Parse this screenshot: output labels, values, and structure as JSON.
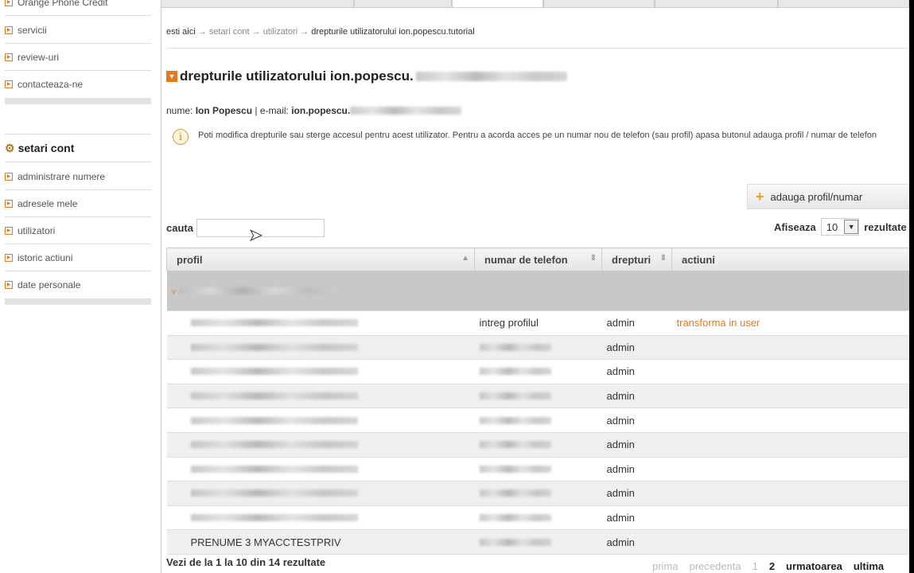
{
  "sidebar": {
    "top_items": [
      "Orange Phone Credit",
      "servicii",
      "review-uri",
      "contacteaza-ne"
    ],
    "section_title": "setari cont",
    "section_items": [
      "administrare numere",
      "adresele mele",
      "utilizatori",
      "istoric actiuni",
      "date personale"
    ]
  },
  "breadcrumb": {
    "prefix": "esti aici",
    "items": [
      "setari cont",
      "utilizatori"
    ],
    "current": "drepturile utilizatorului ion.popescu.tutorial",
    "arrow": "→"
  },
  "page": {
    "title": "drepturile utilizatorului ion.popescu.",
    "name_label": "nume:",
    "name": "Ion Popescu",
    "sep": "|",
    "email_label": "e-mail:",
    "email": "ion.popescu.",
    "info": "Poti modifica drepturile sau sterge accesul pentru acest utilizator. Pentru a acorda acces pe un numar nou de telefon (sau profil) apasa butonul adauga profil / numar de telefon",
    "add_button": "adauga profil/numar",
    "search_label": "cauta",
    "search_value": "",
    "show_label": "Afiseaza",
    "show_value": "10",
    "show_suffix": "rezultate"
  },
  "table": {
    "headers": [
      "profil",
      "numar de telefon",
      "drepturi",
      "actiuni"
    ],
    "rows": [
      {
        "profil": "",
        "phone": "intreg profilul",
        "rights": "admin",
        "action": "transforma in user"
      },
      {
        "profil": "",
        "phone": "",
        "rights": "admin",
        "action": ""
      },
      {
        "profil": "",
        "phone": "",
        "rights": "admin",
        "action": ""
      },
      {
        "profil": "",
        "phone": "",
        "rights": "admin",
        "action": ""
      },
      {
        "profil": "",
        "phone": "",
        "rights": "admin",
        "action": ""
      },
      {
        "profil": "",
        "phone": "",
        "rights": "admin",
        "action": ""
      },
      {
        "profil": "",
        "phone": "",
        "rights": "admin",
        "action": ""
      },
      {
        "profil": "",
        "phone": "",
        "rights": "admin",
        "action": ""
      },
      {
        "profil": "",
        "phone": "",
        "rights": "admin",
        "action": ""
      },
      {
        "profil": "PRENUME 3 MYACCTESTPRIV",
        "phone": "",
        "rights": "admin",
        "action": ""
      }
    ]
  },
  "footer": {
    "summary": "Vezi de la 1 la 10 din 14 rezultate",
    "pager": {
      "first": "prima",
      "prev": "precedenta",
      "pages": [
        "1",
        "2"
      ],
      "next": "urmatoarea",
      "last": "ultima"
    }
  }
}
